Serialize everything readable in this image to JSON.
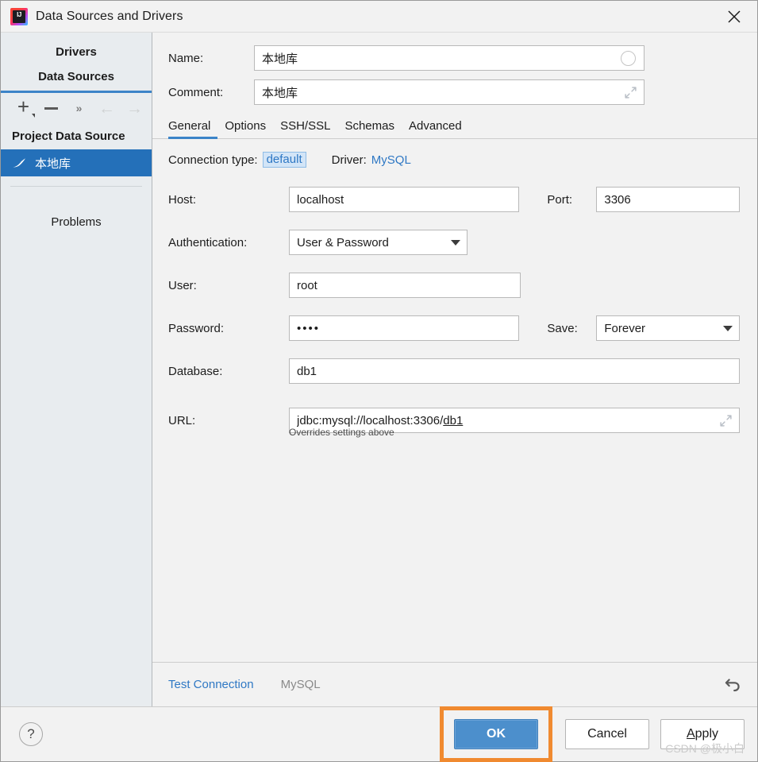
{
  "window": {
    "title": "Data Sources and Drivers",
    "app_icon": "intellij-idea-icon",
    "close_label": "✕"
  },
  "sidebar": {
    "tabs": [
      {
        "label": "Drivers",
        "active": false
      },
      {
        "label": "Data Sources",
        "active": true
      }
    ],
    "toolbar": [
      {
        "name": "add-button",
        "glyph": "+"
      },
      {
        "name": "remove-button",
        "glyph": "−"
      },
      {
        "name": "more-button",
        "glyph": "»"
      },
      {
        "name": "back-button",
        "glyph": "←"
      },
      {
        "name": "forward-button",
        "glyph": "→"
      }
    ],
    "group_header": "Project Data Source",
    "items": [
      {
        "label": "本地库",
        "icon": "mysql-dolphin-icon",
        "selected": true
      }
    ],
    "problems_label": "Problems"
  },
  "form": {
    "name": {
      "label": "Name:",
      "value": "本地库",
      "placeholder": ""
    },
    "comment": {
      "label": "Comment:",
      "value": "本地库",
      "placeholder": ""
    }
  },
  "tabs": [
    {
      "label": "General",
      "active": true
    },
    {
      "label": "Options",
      "active": false
    },
    {
      "label": "SSH/SSL",
      "active": false
    },
    {
      "label": "Schemas",
      "active": false
    },
    {
      "label": "Advanced",
      "active": false
    }
  ],
  "general": {
    "connection_type_label": "Connection type:",
    "connection_type_value": "default",
    "driver_label": "Driver:",
    "driver_value": "MySQL",
    "host": {
      "label": "Host:",
      "value": "localhost"
    },
    "port": {
      "label": "Port:",
      "value": "3306"
    },
    "authentication": {
      "label": "Authentication:",
      "value": "User & Password"
    },
    "user": {
      "label": "User:",
      "value": "root"
    },
    "password": {
      "label": "Password:",
      "value": "••••"
    },
    "save": {
      "label": "Save:",
      "value": "Forever"
    },
    "database": {
      "label": "Database:",
      "value": "db1"
    },
    "url": {
      "label": "URL:",
      "value_prefix": "jdbc:mysql://localhost:3306/",
      "value_underlined": "db1",
      "full_value": "jdbc:mysql://localhost:3306/db1",
      "hint": "Overrides settings above"
    }
  },
  "pane_bottom": {
    "test_connection": "Test Connection",
    "driver_name": "MySQL",
    "revert_icon": "revert-arrow-icon"
  },
  "footer": {
    "help_label": "?",
    "ok_label": "OK",
    "cancel_label": "Cancel",
    "apply_label_before": "A",
    "apply_label_after": "pply",
    "apply_label": "Apply"
  },
  "watermark": "CSDN @极小白",
  "colors": {
    "accent_blue": "#3c84c8",
    "selection_blue": "#2470b9",
    "primary_button": "#4c8fcc",
    "link_blue": "#2f78c4",
    "highlight_orange": "#f08a30",
    "sidebar_bg": "#e8ecef",
    "panel_bg": "#f2f2f2"
  }
}
